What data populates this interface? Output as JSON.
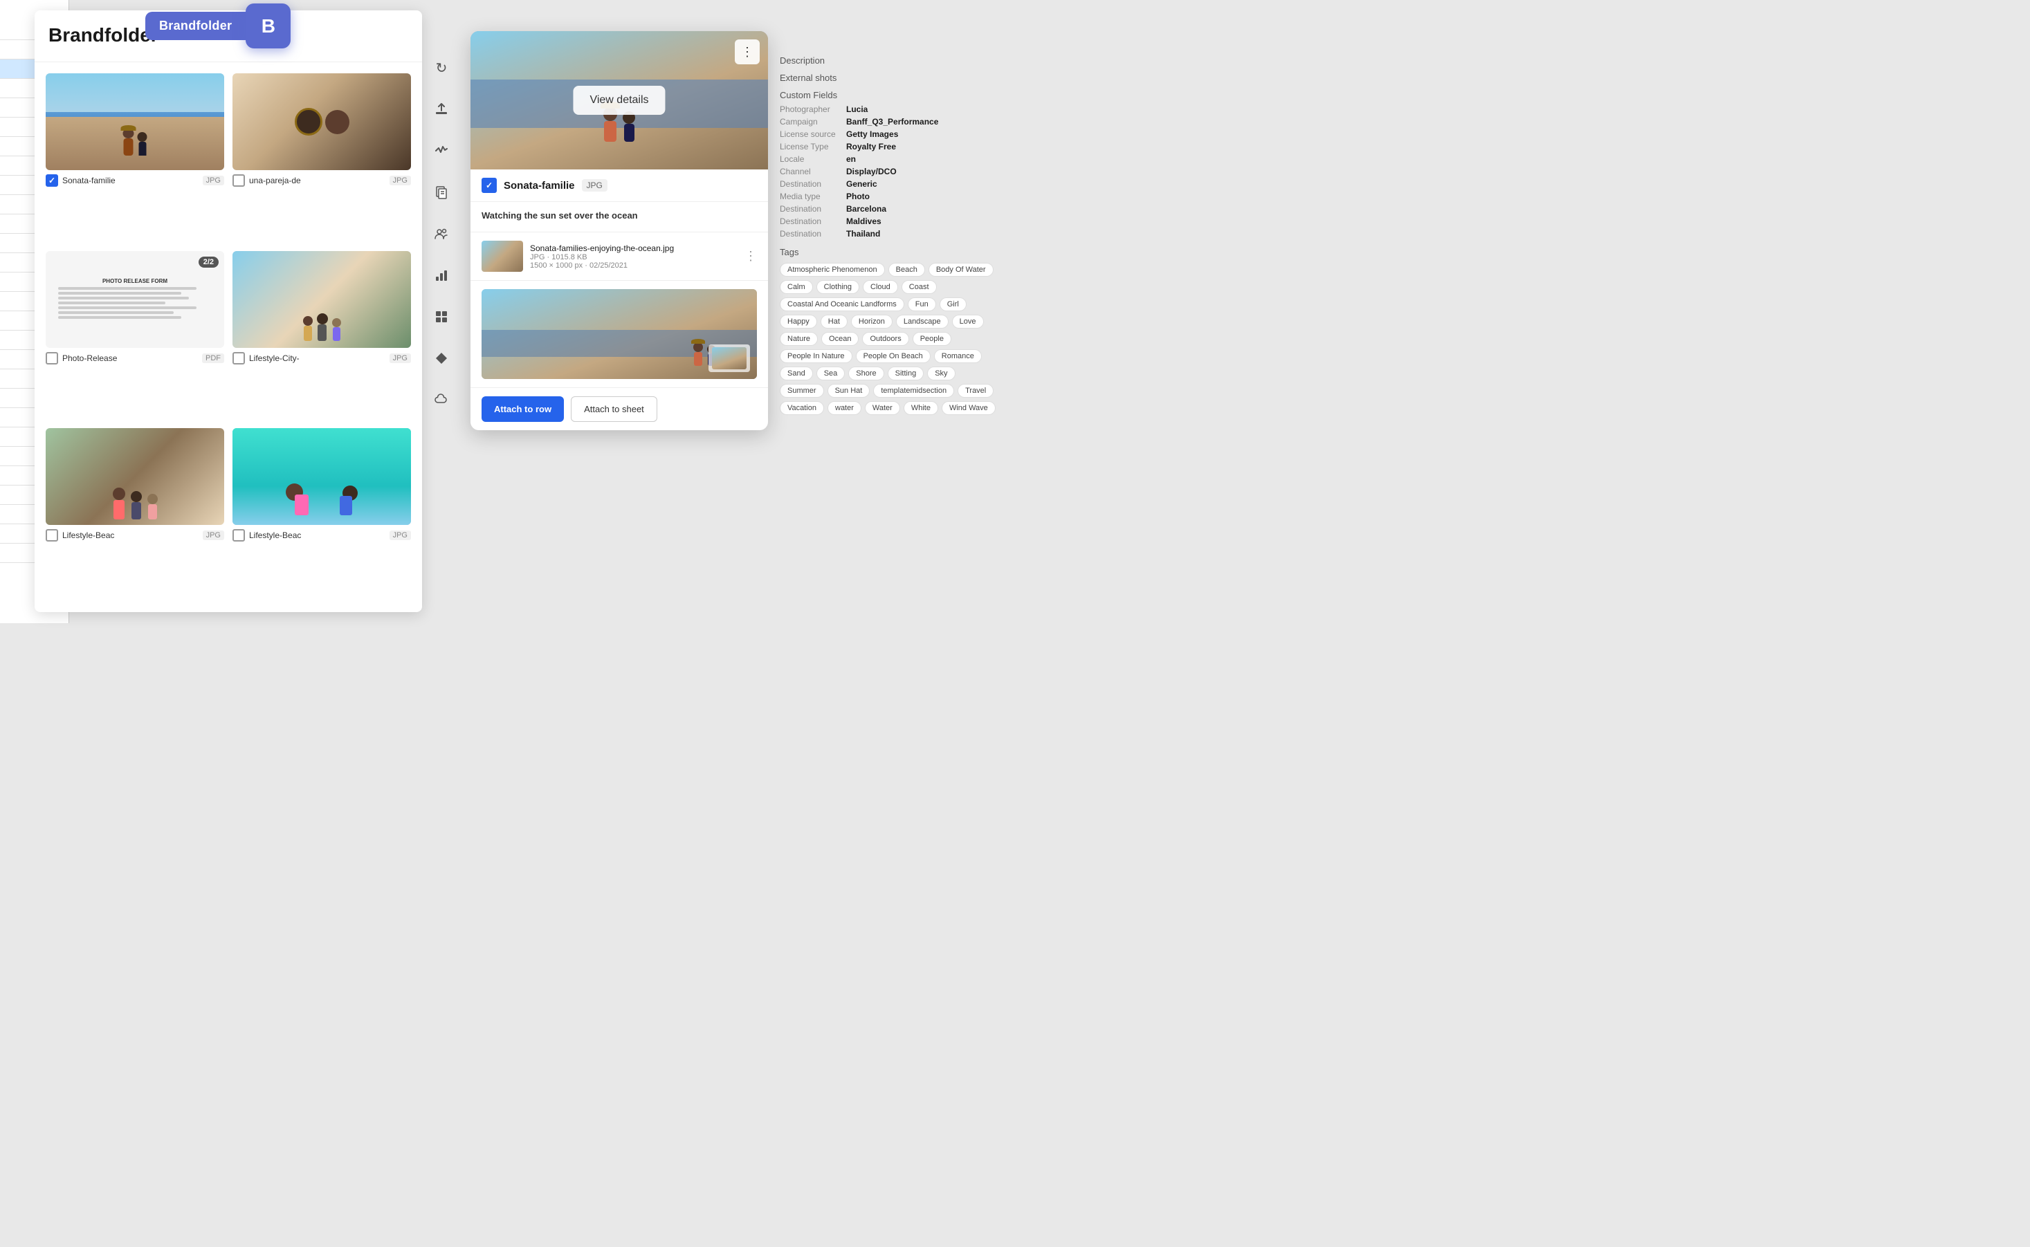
{
  "app": {
    "title": "Brandfolder",
    "logo_text": "Brandfolder",
    "logo_icon": "B"
  },
  "spreadsheet": {
    "lines": [
      {
        "selected": false
      },
      {
        "selected": false
      },
      {
        "selected": true
      },
      {
        "selected": false
      },
      {
        "selected": false
      },
      {
        "selected": false
      },
      {
        "selected": false
      },
      {
        "selected": false
      },
      {
        "selected": false
      },
      {
        "selected": false
      },
      {
        "selected": false
      },
      {
        "selected": false
      },
      {
        "selected": false
      },
      {
        "selected": false
      },
      {
        "selected": false
      },
      {
        "selected": false
      },
      {
        "selected": false
      },
      {
        "selected": false
      },
      {
        "selected": false
      },
      {
        "selected": false
      },
      {
        "selected": false
      },
      {
        "selected": false
      },
      {
        "selected": false
      },
      {
        "selected": false
      },
      {
        "selected": false
      },
      {
        "selected": false
      },
      {
        "selected": false
      },
      {
        "selected": false
      }
    ]
  },
  "brandfolder": {
    "title": "Brandfolder",
    "items": [
      {
        "id": "item-1",
        "name": "Sonata-familie",
        "type": "JPG",
        "checked": true,
        "img_type": "beach-couple",
        "badge": null
      },
      {
        "id": "item-2",
        "name": "una-pareja-de",
        "type": "JPG",
        "checked": false,
        "img_type": "sunglasses",
        "badge": null
      },
      {
        "id": "item-3",
        "name": "Photo-Release",
        "type": "PDF",
        "checked": false,
        "img_type": "photo-release",
        "badge": "2/2"
      },
      {
        "id": "item-4",
        "name": "Lifestyle-City-",
        "type": "JPG",
        "checked": false,
        "img_type": "lifestyle-city",
        "badge": null
      },
      {
        "id": "item-5",
        "name": "Lifestyle-Beac",
        "type": "JPG",
        "checked": false,
        "img_type": "lifestyle-beach1",
        "badge": null
      },
      {
        "id": "item-6",
        "name": "Lifestyle-Beac",
        "type": "JPG",
        "checked": false,
        "img_type": "lifestyle-beach2",
        "badge": null
      }
    ]
  },
  "asset_detail": {
    "asset_name": "Sonata-familie",
    "asset_type": "JPG",
    "view_details_label": "View details",
    "more_icon": "⋮",
    "description_title": "Watching the sun set over the ocean",
    "file_name": "Sonata-families-enjoying-the-ocean.jpg",
    "file_type": "JPG",
    "file_size": "1015.8 KB",
    "file_dimensions": "1500 × 1000 px",
    "file_date": "02/25/2021",
    "attach_row_label": "Attach to row",
    "attach_sheet_label": "Attach to sheet"
  },
  "details_panel": {
    "description_label": "Description",
    "external_shots_label": "External shots",
    "custom_fields_label": "Custom Fields",
    "fields": [
      {
        "label": "Photographer",
        "value": "Lucia"
      },
      {
        "label": "Campaign",
        "value": "Banff_Q3_Performance"
      },
      {
        "label": "License source",
        "value": "Getty Images"
      },
      {
        "label": "License Type",
        "value": "Royalty Free"
      },
      {
        "label": "Locale",
        "value": "en"
      },
      {
        "label": "Channel",
        "value": "Display/DCO"
      },
      {
        "label": "Destination",
        "value": "Generic"
      },
      {
        "label": "Media type",
        "value": "Photo"
      },
      {
        "label": "Destination",
        "value": "Barcelona"
      },
      {
        "label": "Destination",
        "value": "Maldives"
      },
      {
        "label": "Destination",
        "value": "Thailand"
      }
    ],
    "tags_label": "Tags",
    "tags": [
      "Atmospheric Phenomenon",
      "Beach",
      "Body Of Water",
      "Calm",
      "Clothing",
      "Cloud",
      "Coast",
      "Coastal And Oceanic Landforms",
      "Fun",
      "Girl",
      "Happy",
      "Hat",
      "Horizon",
      "Landscape",
      "Love",
      "Nature",
      "Ocean",
      "Outdoors",
      "People",
      "People In Nature",
      "People On Beach",
      "Romance",
      "Sand",
      "Sea",
      "Shore",
      "Sitting",
      "Sky",
      "Summer",
      "Sun Hat",
      "templatemidsection",
      "Travel",
      "Vacation",
      "water",
      "Water",
      "White",
      "Wind Wave"
    ]
  },
  "sidebar_icons": [
    {
      "name": "refresh-icon",
      "symbol": "↻"
    },
    {
      "name": "upload-icon",
      "symbol": "⬆"
    },
    {
      "name": "activity-icon",
      "symbol": "〜"
    },
    {
      "name": "documents-icon",
      "symbol": "▤"
    },
    {
      "name": "people-icon",
      "symbol": "👥"
    },
    {
      "name": "chart-icon",
      "symbol": "▦"
    },
    {
      "name": "grid-icon",
      "symbol": "⊞"
    },
    {
      "name": "diamond-icon",
      "symbol": "◆"
    },
    {
      "name": "cloud-icon",
      "symbol": "☁"
    }
  ]
}
